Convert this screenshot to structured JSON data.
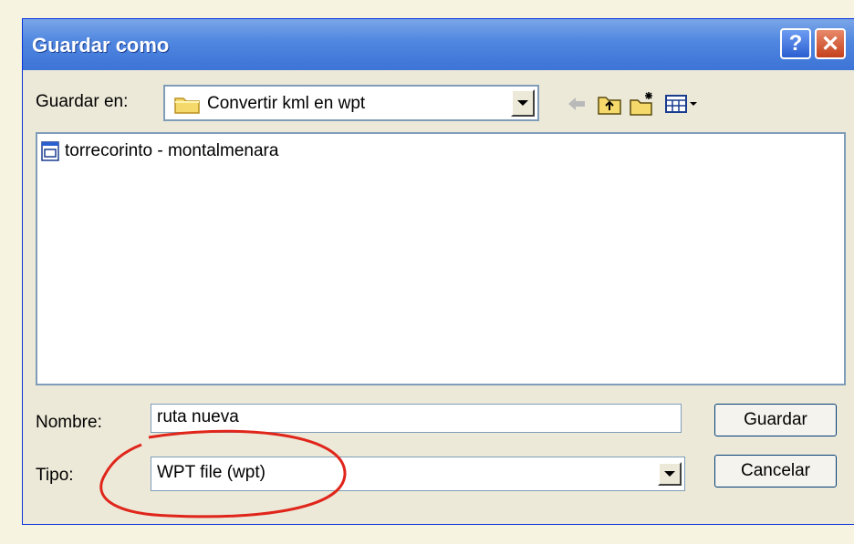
{
  "window": {
    "title": "Guardar como",
    "help_label": "?",
    "close_label": "✕"
  },
  "location": {
    "label": "Guardar en:",
    "value": "Convertir kml en wpt"
  },
  "toolbar": {
    "icons": [
      "back-arrow-icon",
      "up-folder-icon",
      "new-folder-icon",
      "view-menu-icon"
    ]
  },
  "file_list": {
    "items": [
      {
        "name": "torrecorinto - montalmenara",
        "icon": "document-icon"
      }
    ]
  },
  "name_field": {
    "label": "Nombre:",
    "value": "ruta nueva"
  },
  "type_field": {
    "label": "Tipo:",
    "value": "WPT file (wpt)"
  },
  "buttons": {
    "save": "Guardar",
    "cancel": "Cancelar"
  },
  "colors": {
    "title_bar": "#4f86e0",
    "annotation": "#e0251b"
  }
}
